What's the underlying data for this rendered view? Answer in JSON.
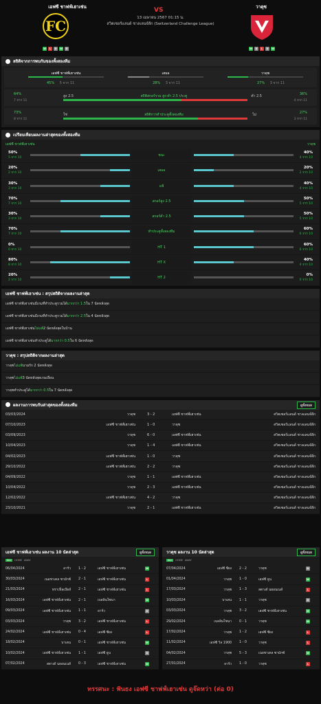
{
  "home": {
    "name": "เอฟซี ชาฟฟ์เฮาเซ่น",
    "form": [
      "W",
      "L",
      "D",
      "W",
      "D"
    ]
  },
  "away": {
    "name": "วาดุซ",
    "form": [
      "W",
      "D",
      "L",
      "D",
      "W"
    ]
  },
  "vs": "VS",
  "match": {
    "datetime": "13 เมษายน 2567 01:15 น.",
    "league": "สวิตเซอร์แลนด์ ชาลเลนจ์ลีก (Switzerland Challenge League)"
  },
  "h2h_title": "สถิติจากการพบกันของทั้งสองทีม",
  "h2h": {
    "home_label": "เอฟซี ชาฟฟ์เฮาเซ่น",
    "home_pct": "45%",
    "home_n": "5 จาก 11",
    "draw_label": "เสมอ",
    "draw_pct": "28%",
    "draw_n": "3 จาก 11",
    "away_label": "วาดุซ",
    "away_pct": "27%",
    "away_n": "3 จาก 11",
    "ou_left_pct": "64%",
    "ou_left_n": "7 จาก 11",
    "ou_over": "สูง 2.5",
    "ou_title": "สถิติสกอร์รวม สูง-ต่ำ 2.5 ประตู",
    "ou_under": "ต่ำ 2.5",
    "ou_right_pct": "36%",
    "ou_right_n": "4 จาก 11",
    "bt_left_pct": "73%",
    "bt_left_n": "8 จาก 11",
    "bt_yes": "ใช่",
    "bt_title": "สถิติการทำประตูทั้งสองทีม",
    "bt_no": "ไม่",
    "bt_right_pct": "27%",
    "bt_right_n": "3 จาก 11"
  },
  "cmp_title": "เปรียบเทียบผลงานล่าสุดของทั้งสองทีม",
  "cmp_home": "เอฟซี ชาฟฟ์เฮาเซ่น",
  "cmp_away": "วาดุซ",
  "cmp": [
    {
      "label": "ชนะ",
      "l": "50%",
      "ln": "5 จาก 10",
      "r": "40%",
      "rn": "4 จาก 10",
      "lv": 50,
      "rv": 40
    },
    {
      "label": "เสมอ",
      "l": "20%",
      "ln": "2 จาก 10",
      "r": "20%",
      "rn": "2 จาก 10",
      "lv": 20,
      "rv": 20
    },
    {
      "label": "แพ้",
      "l": "30%",
      "ln": "3 จาก 10",
      "r": "40%",
      "rn": "4 จาก 10",
      "lv": 30,
      "rv": 40
    },
    {
      "label": "สกอร์สูง 2.5",
      "l": "70%",
      "ln": "7 จาก 10",
      "r": "50%",
      "rn": "5 จาก 10",
      "lv": 70,
      "rv": 50
    },
    {
      "label": "สกอร์ต่ำ 2.5",
      "l": "30%",
      "ln": "3 จาก 10",
      "r": "50%",
      "rn": "5 จาก 10",
      "lv": 30,
      "rv": 50
    },
    {
      "label": "ทำประตูทั้งสองทีม",
      "l": "70%",
      "ln": "7 จาก 10",
      "r": "60%",
      "rn": "6 จาก 10",
      "lv": 70,
      "rv": 60
    },
    {
      "label": "HT 1",
      "l": "0%",
      "ln": "0 จาก 10",
      "r": "60%",
      "rn": "6 จาก 10",
      "lv": 0,
      "rv": 60
    },
    {
      "label": "HT X",
      "l": "80%",
      "ln": "8 จาก 10",
      "r": "40%",
      "rn": "4 จาก 10",
      "lv": 80,
      "rv": 40
    },
    {
      "label": "HT 2",
      "l": "20%",
      "ln": "2 จาก 10",
      "r": "0%",
      "rn": "0 จาก 10",
      "lv": 20,
      "rv": 0
    }
  ],
  "sum_home_title": "เอฟซี ชาฟฟ์เฮาเซ่น : สรุปสถิติจากผลงานล่าสุด",
  "sum_home": [
    [
      "เอฟซี ชาฟฟ์เฮาเซ่น",
      " มีเกมที่ทำประตูรวมได้ ",
      "มากกว่า 1.5",
      " ใน 7 นัดหลังสุด"
    ],
    [
      "เอฟซี ชาฟฟ์เฮาเซ่น",
      " มีเกมที่ทำประตูรวมได้ ",
      "มากกว่า 2.5",
      " ใน 4 นัดหลังสุด"
    ],
    [
      "เอฟซี ชาฟฟ์เฮาเซ่น ",
      "ไม่แพ้",
      " 2 นัดหลังสุดในบ้าน",
      ""
    ],
    [
      "เอฟซี ชาฟฟ์เฮาเซ่น",
      " ทำประตูได้ ",
      "มากกว่า 0.5",
      " ใน 6 นัดหลังสุด"
    ]
  ],
  "sum_away_title": "วาดุซ : สรุปสถิติจากผลงานล่าสุด",
  "sum_away": [
    [
      "วาดุซ ",
      "ไม่แพ้",
      " นามรัก 2 นัดหลังสุด",
      ""
    ],
    [
      "วาดุซ ",
      "ไม่แพ้",
      " 3 นัดหลังสุดเกมเยือน",
      ""
    ],
    [
      "วาดุซ",
      " ทำประตูได้ ",
      "มากกว่า 0.5",
      " ใน 7 นัดหลังสุด"
    ]
  ],
  "h2h_list_title": "ผลงานการพบกันล่าสุดของทั้งสองทีม",
  "view_all": "ดูทั้งหมด",
  "h2h_list": [
    [
      "03/03/2024",
      "วาดุซ",
      "3 - 2",
      "เอฟซี ชาฟฟ์เฮาเซ่น",
      "สวิตเซอร์แลนด์ ชาลเลนจ์ลีก"
    ],
    [
      "07/10/2023",
      "เอฟซี ชาฟฟ์เฮาเซ่น",
      "1 - 0",
      "วาดุซ",
      "สวิตเซอร์แลนด์ ชาลเลนจ์ลีก"
    ],
    [
      "03/09/2023",
      "วาดุซ",
      "6 - 0",
      "เอฟซี ชาฟฟ์เฮาเซ่น",
      "สวิตเซอร์แลนด์ ชาลเลนจ์ลีก"
    ],
    [
      "10/04/2023",
      "วาดุซ",
      "1 - 4",
      "เอฟซี ชาฟฟ์เฮาเซ่น",
      "สวิตเซอร์แลนด์ ชาลเลนจ์ลีก"
    ],
    [
      "04/02/2023",
      "เอฟซี ชาฟฟ์เฮาเซ่น",
      "1 - 0",
      "วาดุซ",
      "สวิตเซอร์แลนด์ ชาลเลนจ์ลีก"
    ],
    [
      "29/10/2022",
      "เอฟซี ชาฟฟ์เฮาเซ่น",
      "2 - 2",
      "วาดุซ",
      "สวิตเซอร์แลนด์ ชาลเลนจ์ลีก"
    ],
    [
      "04/09/2022",
      "วาดุซ",
      "1 - 1",
      "เอฟซี ชาฟฟ์เฮาเซ่น",
      "สวิตเซอร์แลนด์ ชาลเลนจ์ลีก"
    ],
    [
      "10/04/2022",
      "วาดุซ",
      "2 - 3",
      "เอฟซี ชาฟฟ์เฮาเซ่น",
      "สวิตเซอร์แลนด์ ชาลเลนจ์ลีก"
    ],
    [
      "12/02/2022",
      "เอฟซี ชาฟฟ์เฮาเซ่น",
      "4 - 2",
      "วาดุซ",
      "สวิตเซอร์แลนด์ ชาลเลนจ์ลีก"
    ],
    [
      "23/10/2021",
      "วาดุซ",
      "2 - 1",
      "เอฟซี ชาฟฟ์เฮาเซ่น",
      "สวิตเซอร์แลนด์ ชาลเลนจ์ลีก"
    ]
  ],
  "last10_home_title": "เอฟซี ชาฟฟ์เฮาเซ่น ผลงาน 10 นัดล่าสุด",
  "last10_away_title": "วาดุซ ผลงาน 10 นัดล่าสุด",
  "tabs": [
    "ALL",
    "HOME",
    "AWAY"
  ],
  "last10_home": [
    [
      "06/04/2024",
      "อาร์ว",
      "1 - 2",
      "เอฟซี ชาฟฟ์เฮาเซ่น",
      "W"
    ],
    [
      "30/03/2024",
      "เนอชาเตล ซามักซ์",
      "2 - 1",
      "เอฟซี ชาฟฟ์เฮาเซ่น",
      "L"
    ],
    [
      "21/03/2024",
      "ทราเฟ็ลเบ๊ดส์",
      "2 - 1",
      "เอฟซี ชาฟฟ์เฮาเซ่น",
      "L"
    ],
    [
      "16/03/2024",
      "เอฟซี ชาฟฟ์เฮาเซ่น",
      "2 - 1",
      "เบลลินโซนา",
      "W"
    ],
    [
      "09/03/2024",
      "เอฟซี ชาฟฟ์เฮาเซ่น",
      "1 - 1",
      "อาร์ว",
      "D"
    ],
    [
      "03/03/2024",
      "วาดุซ",
      "3 - 2",
      "เอฟซี ชาฟฟ์เฮาเซ่น",
      "L"
    ],
    [
      "24/02/2024",
      "เอฟซี ชาฟฟ์เฮาเซ่น",
      "0 - 4",
      "เอฟซี ซียง",
      "L"
    ],
    [
      "18/02/2024",
      "บาเดน",
      "0 - 1",
      "เอฟซี ชาฟฟ์เฮาเซ่น",
      "W"
    ],
    [
      "10/02/2024",
      "เอฟซี ชาฟฟ์เฮาเซ่น",
      "1 - 1",
      "เอฟซี ธูน",
      "D"
    ],
    [
      "07/02/2024",
      "สตาเด้ นยอนเนส์",
      "0 - 3",
      "เอฟซี ชาฟฟ์เฮาเซ่น",
      "W"
    ]
  ],
  "last10_away": [
    [
      "07/04/2024",
      "เอฟซี ซียง",
      "2 - 2",
      "วาดุซ",
      "D"
    ],
    [
      "01/04/2024",
      "วาดุซ",
      "1 - 0",
      "เอฟซี ธูน",
      "W"
    ],
    [
      "17/03/2024",
      "วาดุซ",
      "1 - 3",
      "สตาเด้ นยอนเนส์",
      "L"
    ],
    [
      "10/03/2024",
      "บาเดน",
      "1 - 1",
      "วาดุซ",
      "D"
    ],
    [
      "03/03/2024",
      "วาดุซ",
      "3 - 2",
      "เอฟซี ชาฟฟ์เฮาเซ่น",
      "W"
    ],
    [
      "29/02/2024",
      "เบลลินโซนา",
      "0 - 1",
      "วาดุซ",
      "W"
    ],
    [
      "17/02/2024",
      "วาดุซ",
      "1 - 2",
      "เอฟซี ซียง",
      "L"
    ],
    [
      "11/02/2024",
      "เอฟซี วิล 1900",
      "1 - 0",
      "วาดุซ",
      "L"
    ],
    [
      "04/02/2024",
      "วาดุซ",
      "5 - 3",
      "เนอชาเตล ซามักซ์",
      "W"
    ],
    [
      "27/01/2024",
      "อาร์ว",
      "1 - 0",
      "วาดุซ",
      "L"
    ]
  ],
  "footer": "ทรรศนะ : ฟันธง เอฟซี ชาฟฟ์เฮาเซ่น ดูจ๊ดหว่า (ต่อ 0)",
  "colors": {
    "win": "#2db84c",
    "loss": "#e03a3a",
    "draw": "#888888",
    "bar": "#5bc8d0"
  }
}
